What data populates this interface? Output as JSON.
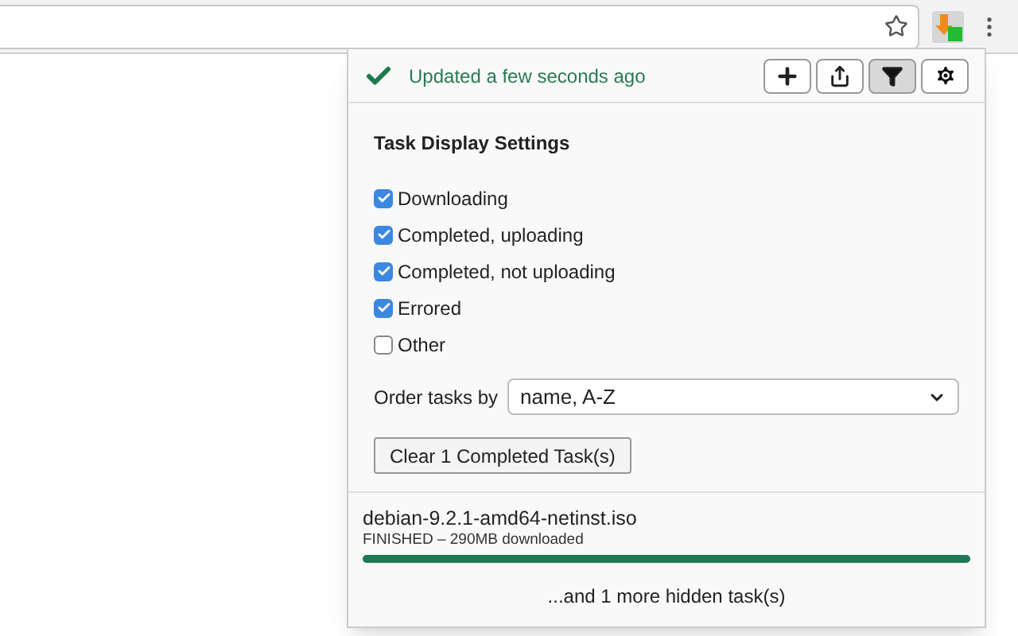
{
  "status": {
    "text": "Updated a few seconds ago",
    "ok": true
  },
  "toolbar_buttons": [
    {
      "kind": "add",
      "selected": false
    },
    {
      "kind": "share",
      "selected": false
    },
    {
      "kind": "filter",
      "selected": true
    },
    {
      "kind": "settings",
      "selected": false
    }
  ],
  "settings": {
    "title": "Task Display Settings",
    "filters": [
      {
        "label": "Downloading",
        "checked": true
      },
      {
        "label": "Completed, uploading",
        "checked": true
      },
      {
        "label": "Completed, not uploading",
        "checked": true
      },
      {
        "label": "Errored",
        "checked": true
      },
      {
        "label": "Other",
        "checked": false
      }
    ],
    "order_label": "Order tasks by",
    "order_value": "name, A-Z",
    "clear_button": "Clear 1 Completed Task(s)"
  },
  "tasks": [
    {
      "name": "debian-9.2.1-amd64-netinst.iso",
      "status": "FINISHED – 290MB downloaded",
      "level": 1
    }
  ],
  "footer": "...and 1 more hidden task(s)"
}
